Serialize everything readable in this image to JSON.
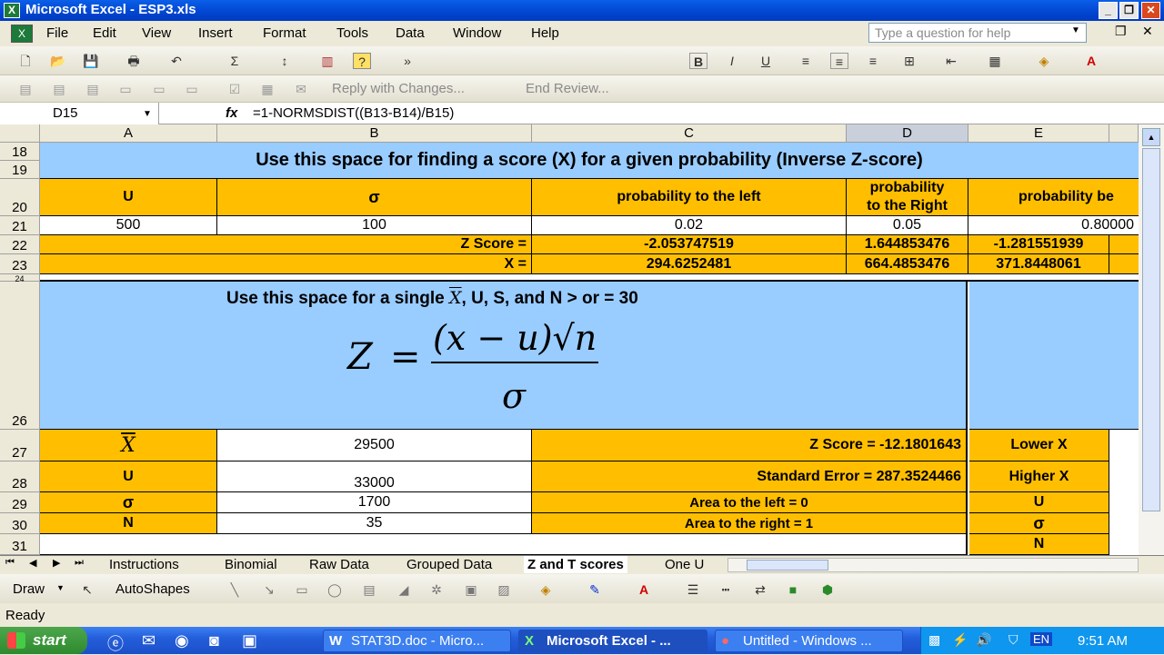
{
  "window": {
    "title": "Microsoft Excel - ESP3.xls",
    "min": "_",
    "restore": "❐",
    "close": "✕"
  },
  "menubar": {
    "items": [
      "File",
      "Edit",
      "View",
      "Insert",
      "Format",
      "Tools",
      "Data",
      "Window",
      "Help"
    ],
    "ask_placeholder": "Type a question for help"
  },
  "toolbar": {
    "font": "Arial",
    "size": "10",
    "reply": "Reply with Changes...",
    "end_review": "End Review..."
  },
  "formula_bar": {
    "name_box": "D15",
    "fx": "fx",
    "formula": "=1-NORMSDIST((B13-B14)/B15)"
  },
  "columns": [
    "A",
    "B",
    "C",
    "D",
    "E"
  ],
  "rows": {
    "r18": "18",
    "r19": "19",
    "r20": "20",
    "r21": "21",
    "r22": "22",
    "r23": "23",
    "r24": "24",
    "r26": "26",
    "r27": "27",
    "r28": "28",
    "r29": "29",
    "r30": "30",
    "r31": "31"
  },
  "sheet": {
    "inverse_title": "Use this space for finding a score (X) for a given probability (Inverse Z-score)",
    "hdr_u": "U",
    "hdr_sigma": "σ",
    "hdr_left": "probability to the left",
    "hdr_right_1": "probability",
    "hdr_right_2": "to the Right",
    "hdr_between": "probability be",
    "r21_a": "500",
    "r21_b": "100",
    "r21_c": "0.02",
    "r21_d": "0.05",
    "r21_e": "0.80000",
    "z_label": "Z Score =",
    "z_c": "-2.053747519",
    "z_d": "1.644853476",
    "z_e": "-1.281551939",
    "x_label": "X =",
    "x_c": "294.6252481",
    "x_d": "664.4853476",
    "x_e": "371.8448061",
    "single_title_pre": "Use this space for a single",
    "single_title_post": ", U, S, and N > or = 30",
    "formula_z": "Z",
    "formula_eq": "=",
    "formula_num": "(x − u)√n",
    "formula_den": "σ",
    "r27_a": "X",
    "r27_b": "29500",
    "r27_c": "Z Score =  -12.1801643",
    "r27_e": "Lower X",
    "r28_a": "U",
    "r28_b": "33000",
    "r28_c": "Standard Error =  287.3524466",
    "r28_e": "Higher X",
    "r29_a": "σ",
    "r29_b": "1700",
    "r29_c": "Area to the left =  0",
    "r29_e": "U",
    "r30_a": "N",
    "r30_b": "35",
    "r30_c": "Area to the right =  1",
    "r30_e": "σ",
    "r31_e": "N"
  },
  "tabs": [
    "Instructions",
    "Binomial",
    "Raw Data",
    "Grouped Data",
    "Z and T scores",
    "One U"
  ],
  "drawbar": {
    "draw": "Draw",
    "autoshapes": "AutoShapes"
  },
  "status": "Ready",
  "taskbar": {
    "start": "start",
    "tasks": [
      "STAT3D.doc - Micro...",
      "Microsoft Excel - ...",
      "Untitled - Windows ..."
    ],
    "lang": "EN",
    "time": "9:51 AM"
  }
}
